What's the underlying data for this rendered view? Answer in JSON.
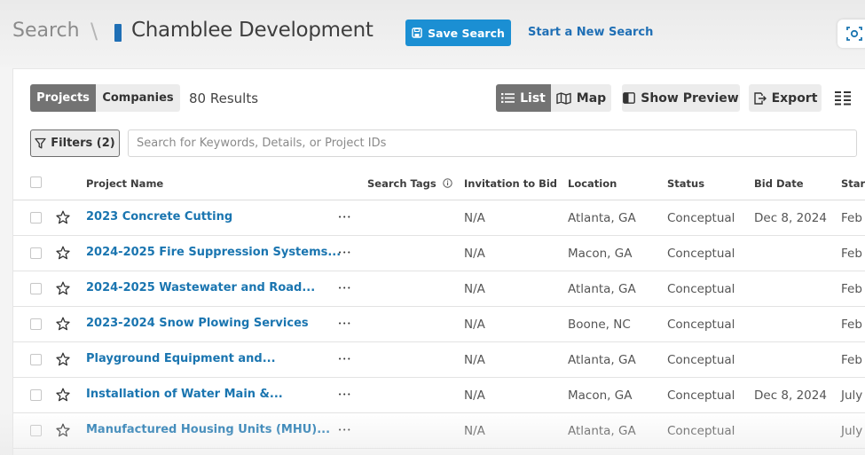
{
  "header": {
    "breadcrumb_root": "Search",
    "separator": "\\",
    "title": "Chamblee Development",
    "save_label": "Save Search",
    "new_search_label": "Start a New Search"
  },
  "toolbar": {
    "tabs": [
      "Projects",
      "Companies"
    ],
    "active_tab": "Projects",
    "results_label": "80 Results",
    "view_list_label": "List",
    "view_map_label": "Map",
    "active_view": "List",
    "preview_label": "Show Preview",
    "export_label": "Export"
  },
  "filters": {
    "label": "Filters (2)",
    "search_placeholder": "Search for Keywords, Details, or Project IDs",
    "search_value": ""
  },
  "table": {
    "columns": [
      "Project Name",
      "Search Tags",
      "Invitation to Bid",
      "Location",
      "Status",
      "Bid Date",
      "Start"
    ],
    "rows": [
      {
        "name": "2023 Concrete Cutting",
        "itb": "N/A",
        "location": "Atlanta, GA",
        "status": "Conceptual",
        "bid_date": "Dec 8, 2024",
        "start": "Feb"
      },
      {
        "name": "2024-2025 Fire Suppression Systems...",
        "itb": "N/A",
        "location": "Macon, GA",
        "status": "Conceptual",
        "bid_date": "",
        "start": "Feb"
      },
      {
        "name": "2024-2025 Wastewater and Road...",
        "itb": "N/A",
        "location": "Atlanta, GA",
        "status": "Conceptual",
        "bid_date": "",
        "start": "Feb"
      },
      {
        "name": "2023-2024 Snow Plowing Services",
        "itb": "N/A",
        "location": "Boone, NC",
        "status": "Conceptual",
        "bid_date": "",
        "start": "Feb"
      },
      {
        "name": "Playground Equipment and...",
        "itb": "N/A",
        "location": "Atlanta, GA",
        "status": "Conceptual",
        "bid_date": "",
        "start": "Feb"
      },
      {
        "name": "Installation of Water Main &...",
        "itb": "N/A",
        "location": "Macon, GA",
        "status": "Conceptual",
        "bid_date": "Dec 8, 2024",
        "start": "July"
      },
      {
        "name": "Manufactured Housing Units (MHU)...",
        "itb": "N/A",
        "location": "Atlanta, GA",
        "status": "Conceptual",
        "bid_date": "",
        "start": "July"
      }
    ]
  },
  "colors": {
    "accent": "#1b8fd3",
    "link": "#1a75b0",
    "active_toggle": "#737373"
  }
}
